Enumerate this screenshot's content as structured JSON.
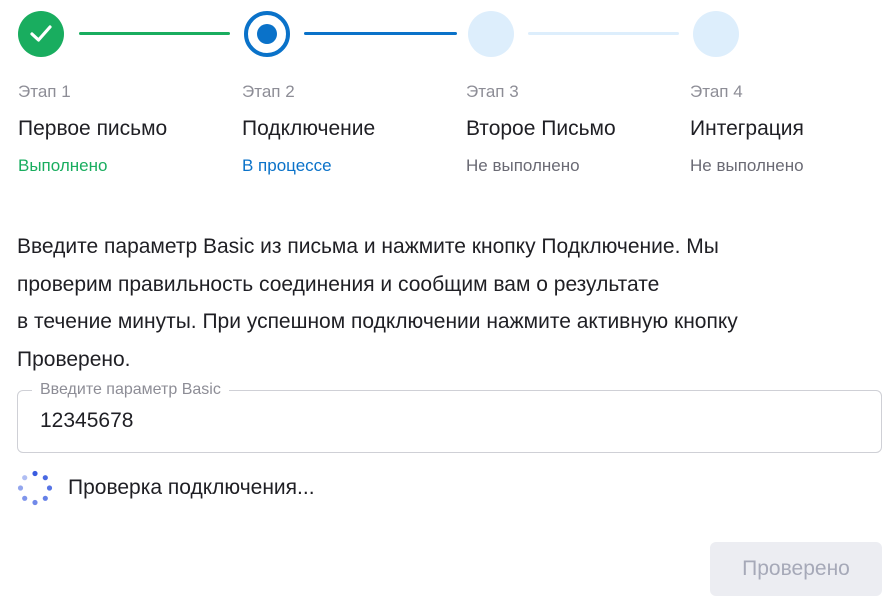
{
  "stepper": {
    "colors": {
      "done": "#19ad5f",
      "active": "#0a72c9",
      "pending": "#ddeefc"
    },
    "steps": [
      {
        "number": "Этап 1",
        "name": "Первое письмо",
        "status": "Выполнено",
        "state": "done",
        "icon": "check-icon"
      },
      {
        "number": "Этап 2",
        "name": "Подключение",
        "status": "В процессе",
        "state": "active",
        "icon": "radio-dot-icon"
      },
      {
        "number": "Этап 3",
        "name": "Второе Письмо",
        "status": "Не выполнено",
        "state": "pending",
        "icon": ""
      },
      {
        "number": "Этап 4",
        "name": "Интеграция",
        "status": "Не выполнено",
        "state": "pending",
        "icon": ""
      }
    ]
  },
  "instructions": {
    "lines": [
      "Введите параметр Basic из письма и нажмите кнопку Подключение. Мы",
      "проверим правильность соединения и сообщим вам о результате",
      "в течение минуты. При успешном подключении нажмите активную кнопку",
      "Проверено."
    ]
  },
  "basic_field": {
    "label": "Введите параметр Basic",
    "value": "12345678"
  },
  "connection_status": {
    "icon": "loading-spinner-icon",
    "text": "Проверка подключения...",
    "color": "#3a5ce0"
  },
  "verify_button": {
    "label": "Проверено",
    "disabled": true
  }
}
